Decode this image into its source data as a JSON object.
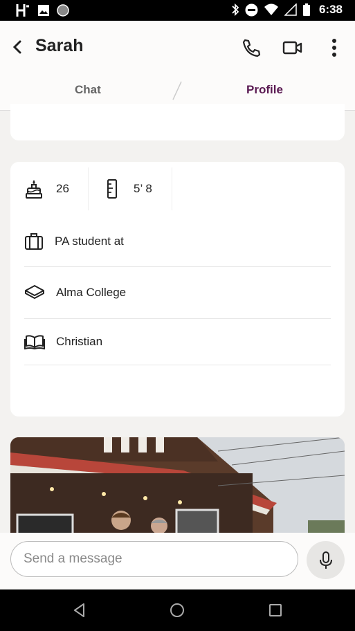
{
  "status_bar": {
    "time": "6:38"
  },
  "header": {
    "contact_name": "Sarah"
  },
  "tabs": [
    {
      "label": "Chat",
      "active": false
    },
    {
      "label": "Profile",
      "active": true
    }
  ],
  "profile": {
    "age": "26",
    "height": "5’ 8",
    "job": "PA student at",
    "school": "Alma College",
    "religion": "Christian"
  },
  "composer": {
    "placeholder": "Send a message"
  },
  "colors": {
    "accent": "#5a1a52",
    "background": "#f3f2f0",
    "card": "#ffffff"
  },
  "icons": [
    "back-icon",
    "phone-icon",
    "video-icon",
    "more-icon",
    "cake-icon",
    "ruler-icon",
    "briefcase-icon",
    "graduation-cap-icon",
    "book-icon",
    "mic-icon"
  ]
}
